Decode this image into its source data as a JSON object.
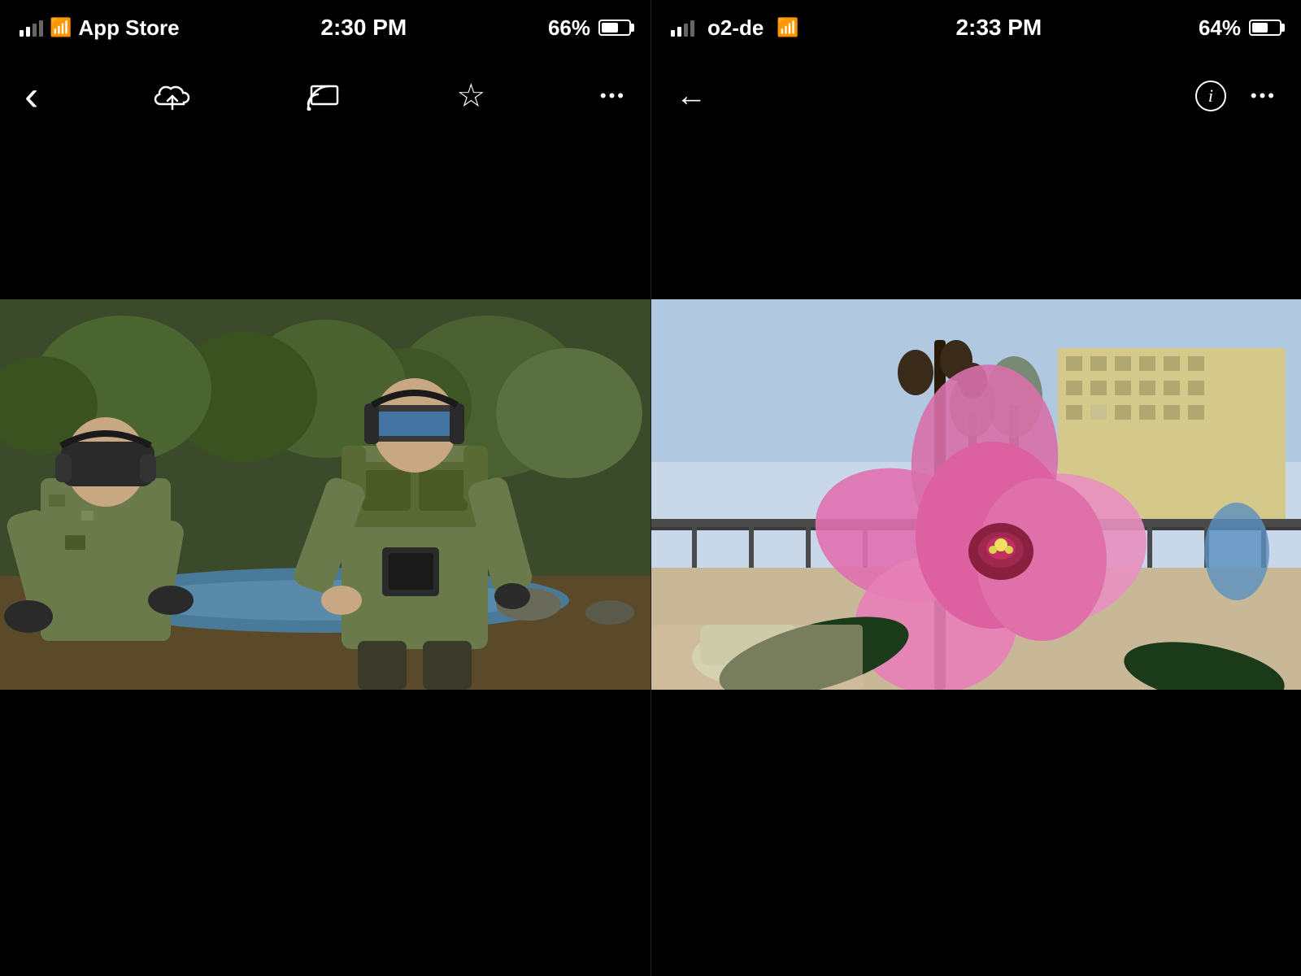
{
  "left_phone": {
    "status_bar": {
      "carrier": "App Store",
      "signal_strength": "2 bars",
      "wifi": true,
      "time": "2:30 PM",
      "battery_percent": "66%"
    },
    "toolbar": {
      "back_label": "‹",
      "cloud_upload_label": "cloud-upload",
      "cast_label": "cast",
      "star_label": "☆",
      "more_label": "•••"
    },
    "image_alt": "Two soldiers wearing AR/VR headsets in an outdoor wooded area near water"
  },
  "right_phone": {
    "status_bar": {
      "carrier": "o2-de",
      "signal_strength": "2 bars",
      "wifi": true,
      "time": "2:33 PM",
      "battery_percent": "64%"
    },
    "toolbar": {
      "back_label": "←",
      "info_label": "i",
      "more_label": "•••"
    },
    "image_alt": "A pink orchid flower in the foreground with a balcony view of a building in the background"
  }
}
